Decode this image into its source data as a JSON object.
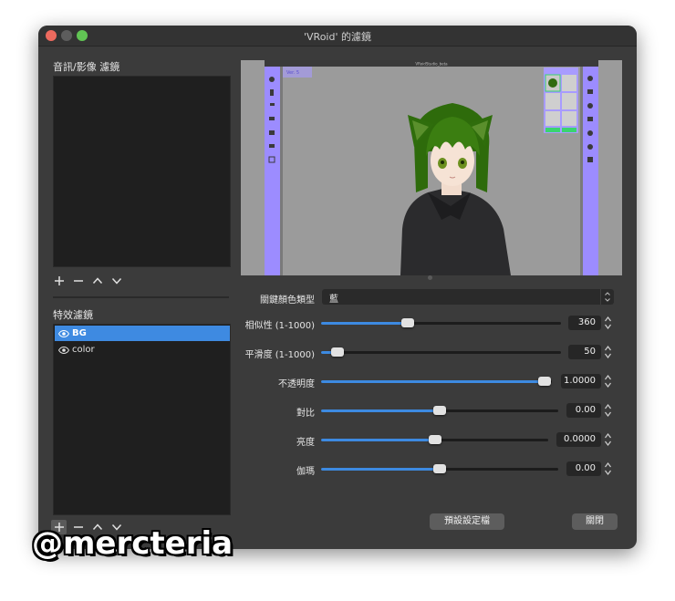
{
  "window": {
    "title": "'VRoid' 的濾鏡"
  },
  "left": {
    "av_section_label": "音訊/影像 濾鏡",
    "effects_section_label": "特效濾鏡",
    "effect_filters": [
      {
        "name": "BG",
        "selected": true
      },
      {
        "name": "color",
        "selected": false
      }
    ]
  },
  "preview": {
    "inner_window_title": "VRoidStudio_beta",
    "inner_tab": "Ver. 5"
  },
  "properties": {
    "key_color_type": {
      "label": "關鍵顏色類型",
      "value": "藍"
    },
    "sliders": [
      {
        "label": "相似性 (1-1000)",
        "value": "360",
        "fraction": 0.36
      },
      {
        "label": "平滑度 (1-1000)",
        "value": "50",
        "fraction": 0.05
      },
      {
        "label": "不透明度",
        "value": "1.0000",
        "fraction": 1.0
      },
      {
        "label": "對比",
        "value": "0.00",
        "fraction": 0.5
      },
      {
        "label": "亮度",
        "value": "0.0000",
        "fraction": 0.5
      },
      {
        "label": "伽瑪",
        "value": "0.00",
        "fraction": 0.5
      }
    ]
  },
  "buttons": {
    "defaults": "預設設定檔",
    "close": "關閉"
  },
  "watermark": "@mercteria",
  "colors": {
    "accent": "#3d8ae1",
    "window_bg": "#3b3b3b",
    "list_bg": "#1f1f1f",
    "chroma_panel": "#9c8cff"
  }
}
